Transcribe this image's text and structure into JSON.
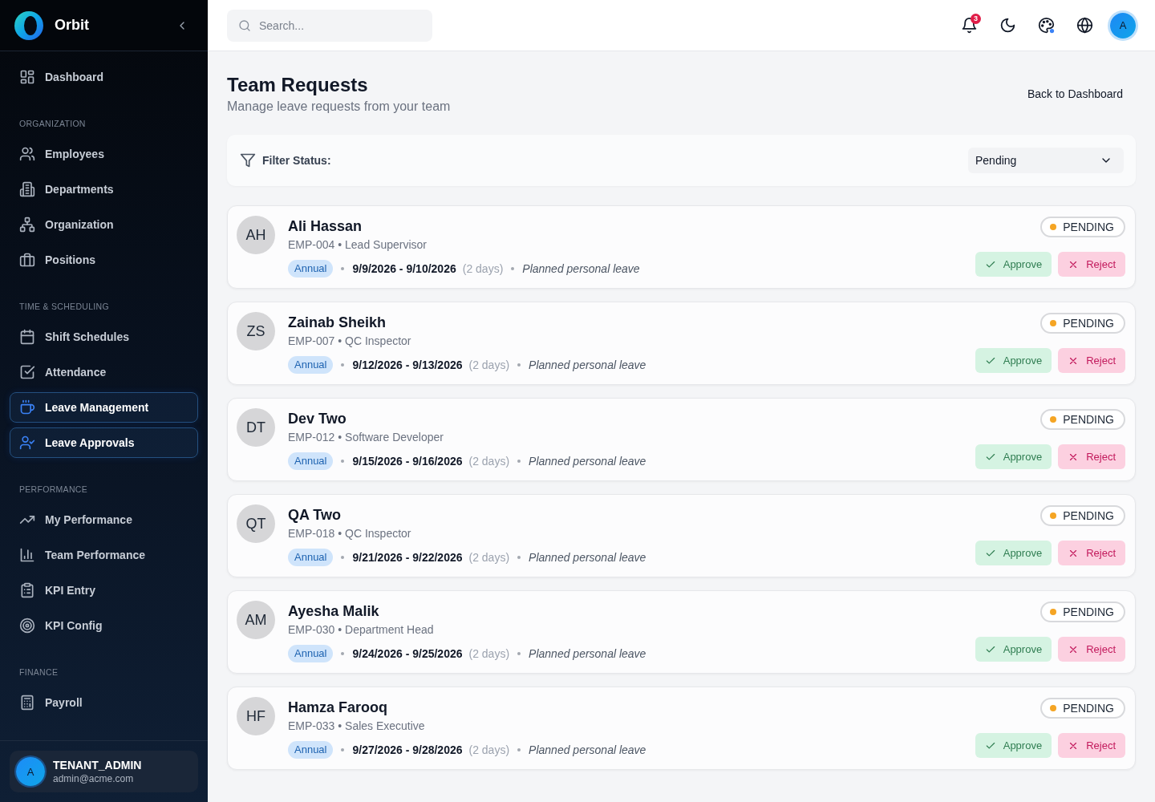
{
  "sidebar": {
    "brand": "Orbit",
    "sections": [
      {
        "items": [
          {
            "label": "Dashboard",
            "selected": false
          }
        ]
      },
      {
        "title": "ORGANIZATION",
        "items": [
          {
            "label": "Employees",
            "selected": false
          },
          {
            "label": "Departments",
            "selected": false
          },
          {
            "label": "Organization",
            "selected": false
          },
          {
            "label": "Positions",
            "selected": false
          }
        ]
      },
      {
        "title": "TIME & SCHEDULING",
        "items": [
          {
            "label": "Shift Schedules",
            "selected": false
          },
          {
            "label": "Attendance",
            "selected": false
          },
          {
            "label": "Leave Management",
            "selected": true
          },
          {
            "label": "Leave Approvals",
            "selected": true
          }
        ]
      },
      {
        "title": "PERFORMANCE",
        "items": [
          {
            "label": "My Performance",
            "selected": false
          },
          {
            "label": "Team Performance",
            "selected": false
          },
          {
            "label": "KPI Entry",
            "selected": false
          },
          {
            "label": "KPI Config",
            "selected": false
          }
        ]
      },
      {
        "title": "FINANCE",
        "items": [
          {
            "label": "Payroll",
            "selected": false
          }
        ]
      }
    ],
    "user": {
      "avatar": "A",
      "name": "TENANT_ADMIN",
      "email": "admin@acme.com"
    }
  },
  "topbar": {
    "search": {
      "placeholder": "Search..."
    },
    "notifications": {
      "count": "3"
    },
    "avatar": "A"
  },
  "page": {
    "title": "Team Requests",
    "subtitle": "Manage leave requests from your team",
    "back_button": "Back to Dashboard"
  },
  "filter": {
    "label": "Filter Status:",
    "value": "Pending"
  },
  "requests": [
    {
      "initials": "AH",
      "name": "Ali Hassan",
      "details": "EMP-004 • Lead Supervisor",
      "leave_type": "Annual",
      "dates": "9/9/2026 - 9/10/2026",
      "duration": "(2 days)",
      "reason": "Planned personal leave",
      "status": "PENDING",
      "approve": "Approve",
      "reject": "Reject"
    },
    {
      "initials": "ZS",
      "name": "Zainab Sheikh",
      "details": "EMP-007 • QC Inspector",
      "leave_type": "Annual",
      "dates": "9/12/2026 - 9/13/2026",
      "duration": "(2 days)",
      "reason": "Planned personal leave",
      "status": "PENDING",
      "approve": "Approve",
      "reject": "Reject"
    },
    {
      "initials": "DT",
      "name": "Dev Two",
      "details": "EMP-012 • Software Developer",
      "leave_type": "Annual",
      "dates": "9/15/2026 - 9/16/2026",
      "duration": "(2 days)",
      "reason": "Planned personal leave",
      "status": "PENDING",
      "approve": "Approve",
      "reject": "Reject"
    },
    {
      "initials": "QT",
      "name": "QA Two",
      "details": "EMP-018 • QC Inspector",
      "leave_type": "Annual",
      "dates": "9/21/2026 - 9/22/2026",
      "duration": "(2 days)",
      "reason": "Planned personal leave",
      "status": "PENDING",
      "approve": "Approve",
      "reject": "Reject"
    },
    {
      "initials": "AM",
      "name": "Ayesha Malik",
      "details": "EMP-030 • Department Head",
      "leave_type": "Annual",
      "dates": "9/24/2026 - 9/25/2026",
      "duration": "(2 days)",
      "reason": "Planned personal leave",
      "status": "PENDING",
      "approve": "Approve",
      "reject": "Reject"
    },
    {
      "initials": "HF",
      "name": "Hamza Farooq",
      "details": "EMP-033 • Sales Executive",
      "leave_type": "Annual",
      "dates": "9/27/2026 - 9/28/2026",
      "duration": "(2 days)",
      "reason": "Planned personal leave",
      "status": "PENDING",
      "approve": "Approve",
      "reject": "Reject"
    }
  ]
}
